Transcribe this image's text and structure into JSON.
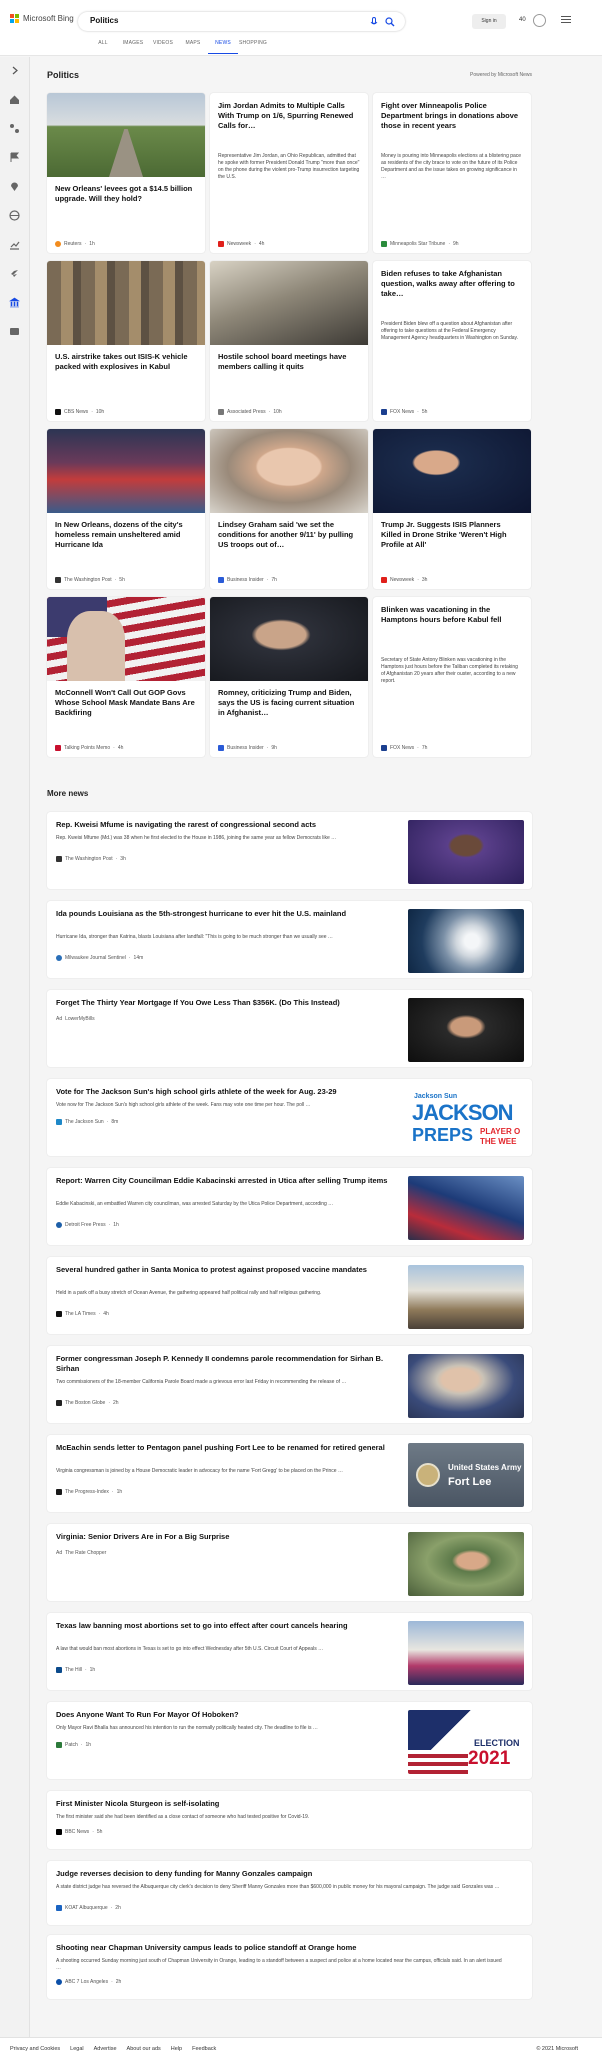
{
  "header": {
    "logo_text": "Microsoft Bing",
    "search_value": "Politics",
    "signin_label": "Sign in",
    "points": "40",
    "tabs": [
      {
        "label": "ALL"
      },
      {
        "label": "IMAGES"
      },
      {
        "label": "VIDEOS"
      },
      {
        "label": "MAPS"
      },
      {
        "label": "NEWS"
      },
      {
        "label": "SHOPPING"
      }
    ],
    "active_tab": "NEWS"
  },
  "colors": {
    "accent": "#174ae4",
    "ms_red": "#f25022",
    "ms_green": "#7fba00",
    "ms_blue": "#00a4ef",
    "ms_yellow": "#ffb900"
  },
  "section": {
    "title": "Politics",
    "powered": "Powered by Microsoft News"
  },
  "cards": [
    {
      "title": "New Orleans' levees got a $14.5 billion upgrade. Will they hold?",
      "source": "Reuters",
      "time": "1h"
    },
    {
      "title": "Jim Jordan Admits to Multiple Calls With Trump on 1/6, Spurring Renewed Calls for…",
      "desc": "Representative Jim Jordan, an Ohio Republican, admitted that he spoke with former President Donald Trump \"more than once\" on the phone during the violent pro-Trump insurrection targeting the U.S.",
      "source": "Newsweek",
      "time": "4h"
    },
    {
      "title": "Fight over Minneapolis Police Department brings in donations above those in recent years",
      "desc": "Money is pouring into Minneapolis elections at a blistering pace as residents of the city brace to vote on the future of its Police Department and as the issue takes on growing significance in …",
      "source": "Minneapolis Star Tribune",
      "time": "9h"
    },
    {
      "title": "U.S. airstrike takes out ISIS-K vehicle packed with explosives in Kabul",
      "source": "CBS News",
      "time": "10h"
    },
    {
      "title": "Hostile school board meetings have members calling it quits",
      "source": "Associated Press",
      "time": "10h"
    },
    {
      "title": "Biden refuses to take Afghanistan question, walks away after offering to take…",
      "desc": "President Biden blew off a question about Afghanistan after offering to take questions at the Federal Emergency Management Agency headquarters in Washington on Sunday.",
      "source": "FOX News",
      "time": "5h"
    },
    {
      "title": "In New Orleans, dozens of the city's homeless remain unsheltered amid Hurricane Ida",
      "source": "The Washington Post",
      "time": "5h"
    },
    {
      "title": "Lindsey Graham said 'we set the conditions for another 9/11' by pulling US troops out of…",
      "source": "Business Insider",
      "time": "7h"
    },
    {
      "title": "Trump Jr. Suggests ISIS Planners Killed in Drone Strike 'Weren't High Profile at All'",
      "source": "Newsweek",
      "time": "3h"
    },
    {
      "title": "McConnell Won't Call Out GOP Govs Whose School Mask Mandate Bans Are Backfiring",
      "source": "Talking Points Memo",
      "time": "4h"
    },
    {
      "title": "Romney, criticizing Trump and Biden, says the US is facing current situation in Afghanist…",
      "source": "Business Insider",
      "time": "9h"
    },
    {
      "title": "Blinken was vacationing in the Hamptons hours before Kabul fell",
      "desc": "Secretary of State Antony Blinken was vacationing in the Hamptons just hours before the Taliban completed its retaking of Afghanistan 20 years after their ouster, according to a new report.",
      "source": "FOX News",
      "time": "7h"
    }
  ],
  "more_news_title": "More news",
  "rows": [
    {
      "title": "Rep. Kweisi Mfume is navigating the rarest of congressional second acts",
      "desc": "Rep. Kweisi Mfume (Md.) was 38 when he first elected to the House in 1986, joining the same year as fellow Democrats like …",
      "source": "The Washington Post",
      "time": "3h"
    },
    {
      "title": "Ida pounds Louisiana as the 5th-strongest hurricane to ever hit the U.S. mainland",
      "desc": "Hurricane Ida, stronger than Katrina, blasts Louisiana after landfall: \"This is going to be much stronger than we usually see …",
      "source": "Milwaukee Journal Sentinel",
      "time": "14m"
    },
    {
      "title": "Forget The Thirty Year Mortgage If You Owe Less Than $356K. (Do This Instead)",
      "ad": "Ad",
      "source": "LowerMyBills"
    },
    {
      "title": "Vote for The Jackson Sun's high school girls athlete of the week for Aug. 23-29",
      "desc": "Vote now for The Jackson Sun's high school girls athlete of the week. Fans may vote one time per hour. The poll …",
      "source": "The Jackson Sun",
      "time": "8m",
      "img_text": [
        "Jackson Sun",
        "JACKSON",
        "PREPS",
        "PLAYER O",
        "THE WEE"
      ]
    },
    {
      "title": "Report: Warren City Councilman Eddie Kabacinski arrested in Utica after selling Trump items",
      "desc": "Eddie Kabacinski, an embattled Warren city councilman, was arrested Saturday by the Utica Police Department, according …",
      "source": "Detroit Free Press",
      "time": "1h"
    },
    {
      "title": "Several hundred gather in Santa Monica to protest against proposed vaccine mandates",
      "desc": "Held in a park off a busy stretch of Ocean Avenue, the gathering appeared half political rally and half religious gathering.",
      "source": "The LA Times",
      "time": "4h"
    },
    {
      "title": "Former congressman Joseph P. Kennedy II condemns parole recommendation for Sirhan B. Sirhan",
      "desc": "Two commissioners of the 18-member California Parole Board made a grievous error last Friday in recommending the release of …",
      "source": "The Boston Globe",
      "time": "2h"
    },
    {
      "title": "McEachin sends letter to Pentagon panel pushing Fort Lee to be renamed for retired general",
      "desc": "Virginia congressman is joined by a House Democratic leader in advocacy for the name 'Fort Gregg' to be placed on the Prince …",
      "source": "The Progress-Index",
      "time": "1h",
      "img_text": [
        "United States Army",
        "Fort Lee"
      ]
    },
    {
      "title": "Virginia: Senior Drivers Are in For a Big Surprise",
      "ad": "Ad",
      "source": "The Rate Chopper"
    },
    {
      "title": "Texas law banning most abortions set to go into effect after court cancels hearing",
      "desc": "A law that would ban most abortions in Texas is set to go into effect Wednesday after 5th U.S. Circuit Court of Appeals …",
      "source": "The Hill",
      "time": "1h"
    },
    {
      "title": "Does Anyone Want To Run For Mayor Of Hoboken?",
      "desc": "Only Mayor Ravi Bhalla has announced his intention to run the normally politically heated city. The deadline to file is …",
      "source": "Patch",
      "time": "1h",
      "img_text": [
        "ELECTION",
        "2021"
      ]
    },
    {
      "title": "First Minister Nicola Sturgeon is self-isolating",
      "desc": "The first minister said she had been identified as a close contact of someone who had tested positive for Covid-19.",
      "source": "BBC News",
      "time": "5h"
    },
    {
      "title": "Judge reverses decision to deny funding for Manny Gonzales campaign",
      "desc": "A state district judge has reversed the Albuquerque city clerk's decision to deny Sheriff Manny Gonzales more than $600,000 in public money for his mayoral campaign. The judge said Gonzales was …",
      "source": "KOAT Albuquerque",
      "time": "2h"
    },
    {
      "title": "Shooting near Chapman University campus leads to police standoff at Orange home",
      "desc": "A shooting occurred Sunday morning just south of Chapman University in Orange, leading to a standoff between a suspect and police at a home located near the campus, officials said. In an alert issued …",
      "source": "ABC 7 Los Angeles",
      "time": "2h"
    }
  ],
  "footer": {
    "links": [
      {
        "label": "Privacy and Cookies"
      },
      {
        "label": "Legal"
      },
      {
        "label": "Advertise"
      },
      {
        "label": "About our ads"
      },
      {
        "label": "Help"
      },
      {
        "label": "Feedback"
      }
    ],
    "copyright": "© 2021 Microsoft"
  }
}
